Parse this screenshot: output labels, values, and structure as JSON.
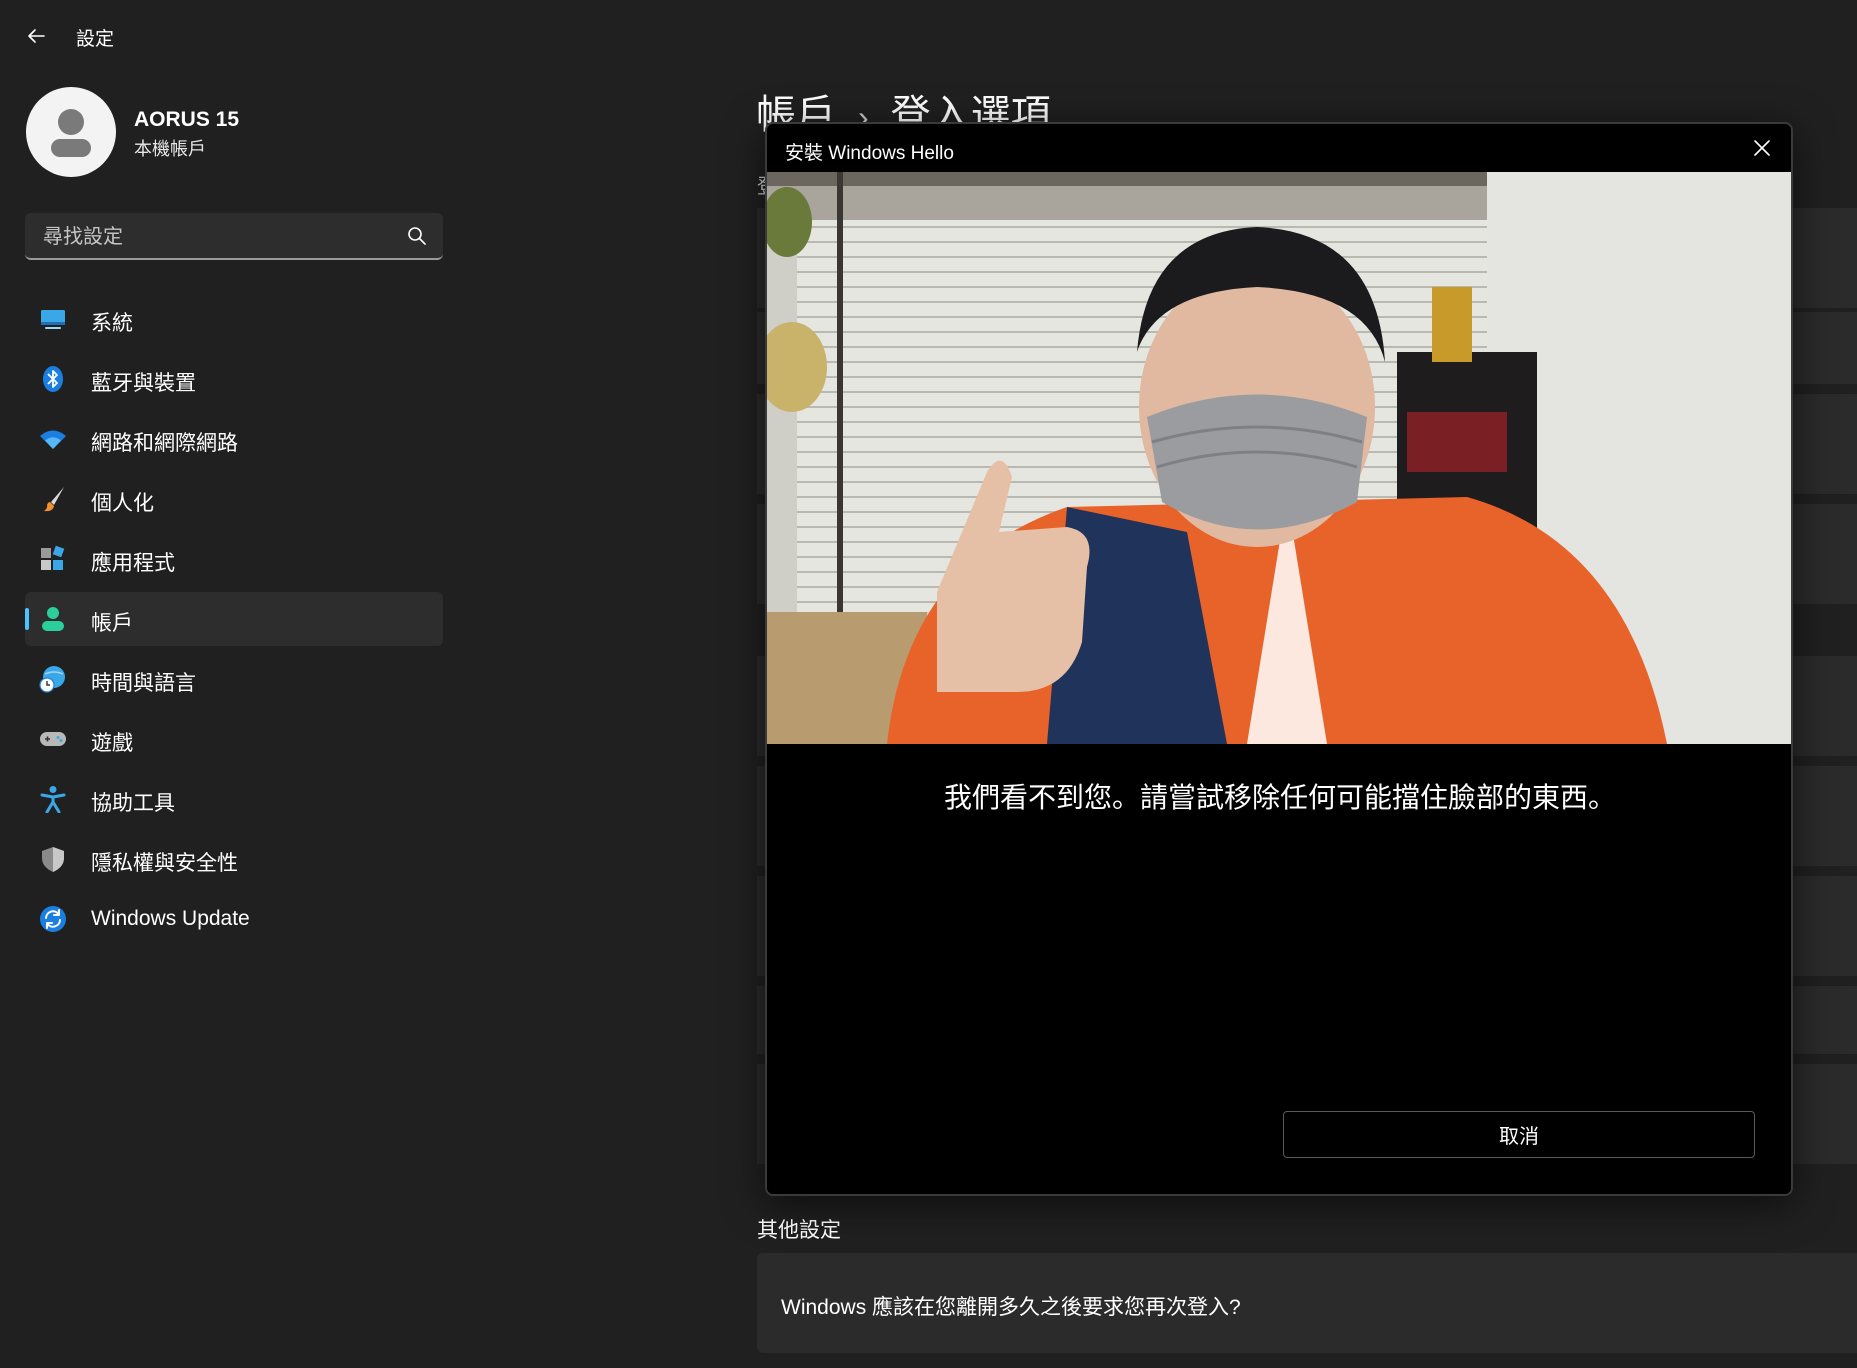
{
  "window": {
    "title": "設定"
  },
  "profile": {
    "name": "AORUS 15",
    "account_type": "本機帳戶"
  },
  "search": {
    "placeholder": "尋找設定"
  },
  "nav": {
    "items": [
      {
        "label": "系統",
        "icon": "system-icon"
      },
      {
        "label": "藍牙與裝置",
        "icon": "bluetooth-icon"
      },
      {
        "label": "網路和網際網路",
        "icon": "wifi-icon"
      },
      {
        "label": "個人化",
        "icon": "paintbrush-icon"
      },
      {
        "label": "應用程式",
        "icon": "apps-icon"
      },
      {
        "label": "帳戶",
        "icon": "account-icon",
        "selected": true
      },
      {
        "label": "時間與語言",
        "icon": "time-language-icon"
      },
      {
        "label": "遊戲",
        "icon": "gamepad-icon"
      },
      {
        "label": "協助工具",
        "icon": "accessibility-icon"
      },
      {
        "label": "隱私權與安全性",
        "icon": "shield-icon"
      },
      {
        "label": "Windows Update",
        "icon": "windows-update-icon"
      }
    ]
  },
  "content": {
    "breadcrumb": {
      "parent": "帳戶",
      "separator": "›",
      "current": "登入選項"
    },
    "partial_text": "登",
    "other_settings_title": "其他設定",
    "setting_away_question": "Windows 應該在您離開多久之後要求您再次登入?"
  },
  "dialog": {
    "title": "安裝 Windows Hello",
    "message": "我們看不到您。請嘗試移除任何可能擋住臉部的東西。",
    "cancel_label": "取消"
  },
  "colors": {
    "accent": "#4cc2ff",
    "background": "#202020",
    "card": "#2b2b2b",
    "dialog": "#000000"
  }
}
